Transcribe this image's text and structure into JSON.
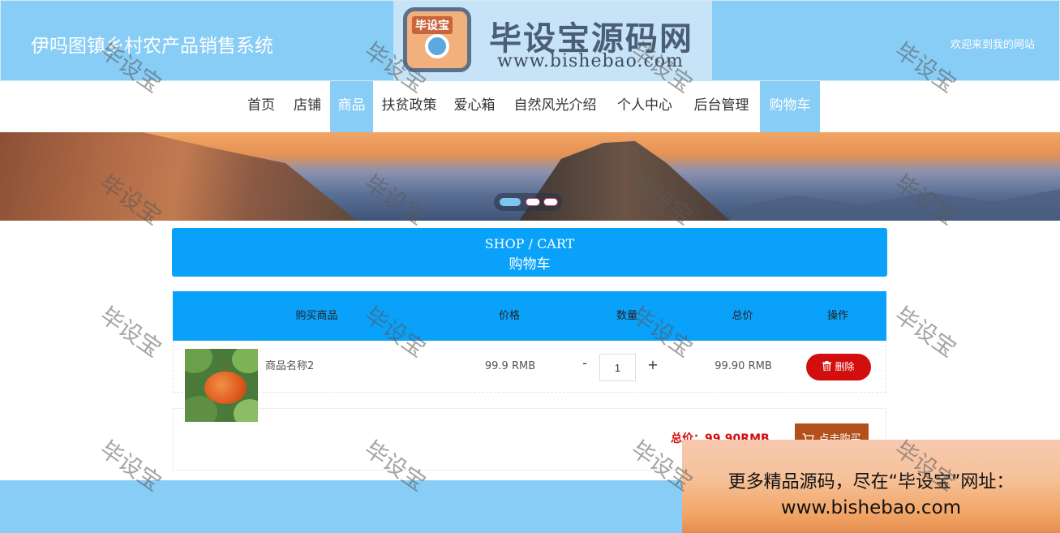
{
  "header": {
    "site_title": "伊吗图镇乡村农产品销售系统",
    "welcome": "欢迎来到我的网站"
  },
  "logo_watermark": {
    "badge_text": "毕设宝",
    "title": "毕设宝源码网",
    "url": "www.bishebao.com"
  },
  "nav": {
    "items": [
      {
        "label": "首页",
        "active": false
      },
      {
        "label": "店铺",
        "active": false
      },
      {
        "label": "商品",
        "active": true
      },
      {
        "label": "扶贫政策",
        "active": false
      },
      {
        "label": "爱心箱",
        "active": false
      },
      {
        "label": "自然风光介绍",
        "active": false
      },
      {
        "label": "个人中心",
        "active": false
      },
      {
        "label": "后台管理",
        "active": false
      },
      {
        "label": "购物车",
        "active": true
      }
    ]
  },
  "banner": {
    "slides": 3,
    "current_slide": 1
  },
  "cart": {
    "heading_en": "SHOP / CART",
    "heading_zh": "购物车",
    "columns": [
      "购买商品",
      "价格",
      "数量",
      "总价",
      "操作"
    ],
    "items": [
      {
        "name": "商品名称2",
        "price": "99.9 RMB",
        "qty_minus": "-",
        "quantity": "1",
        "qty_plus": "+",
        "total": "99.90 RMB",
        "delete_label": "删除",
        "delete_icon": "trash-icon"
      }
    ],
    "summary": {
      "total_text": "总价：99.90RMB",
      "buy_label": "点击购买",
      "buy_icon": "cart-icon"
    }
  },
  "ad": {
    "line1": "更多精品源码，尽在“毕设宝”网址：",
    "line2": "www.bishebao.com"
  },
  "watermark_text": "毕设宝",
  "colors": {
    "header_bg": "#87cdf6",
    "accent_blue": "#0aa1fa",
    "delete_red": "#d20e0e",
    "buy_brown": "#b3501a"
  }
}
